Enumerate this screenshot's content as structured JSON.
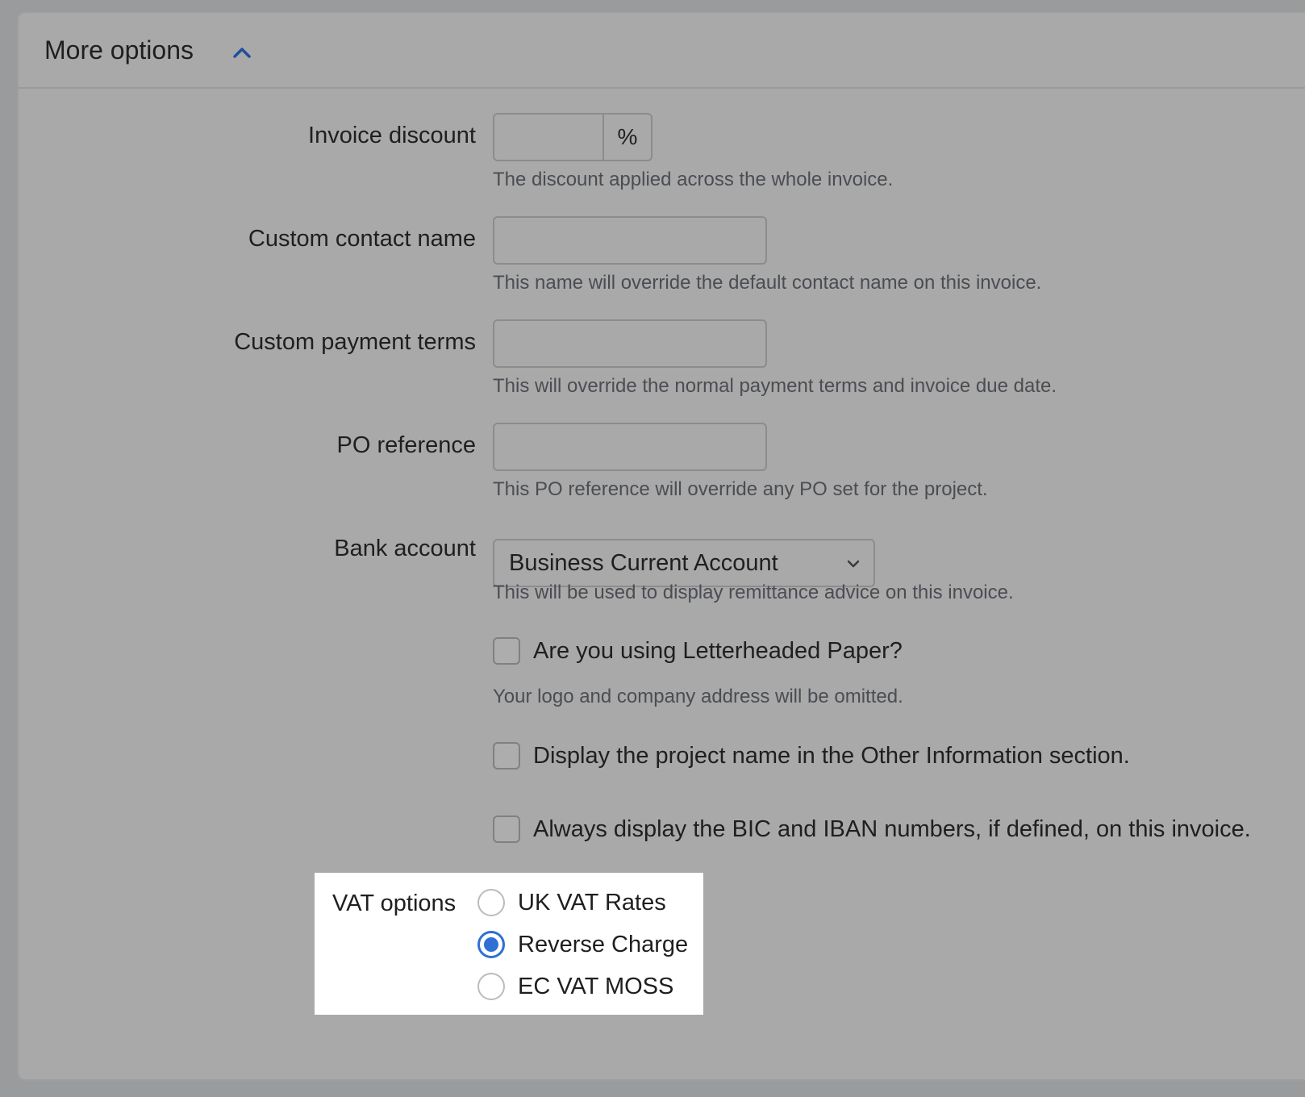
{
  "header": {
    "title": "More options",
    "toggle_icon": "chevron-up-icon",
    "accent_color": "#1f4f9e"
  },
  "invoice_discount": {
    "label": "Invoice discount",
    "value": "",
    "suffix": "%",
    "help": "The discount applied across the whole invoice."
  },
  "custom_contact_name": {
    "label": "Custom contact name",
    "value": "",
    "help": "This name will override the default contact name on this invoice."
  },
  "custom_payment_terms": {
    "label": "Custom payment terms",
    "value": "",
    "help": "This will override the normal payment terms and invoice due date."
  },
  "po_reference": {
    "label": "PO reference",
    "value": "",
    "help": "This PO reference will override any PO set for the project."
  },
  "bank_account": {
    "label": "Bank account",
    "selected": "Business Current Account",
    "help": "This will be used to display remittance advice on this invoice."
  },
  "checkboxes": [
    {
      "label": "Are you using Letterheaded Paper?",
      "checked": false,
      "help": "Your logo and company address will be omitted."
    },
    {
      "label": "Display the project name in the Other Information section.",
      "checked": false
    },
    {
      "label": "Always display the BIC and IBAN numbers, if defined, on this invoice.",
      "checked": false
    }
  ],
  "vat_options": {
    "label": "VAT options",
    "options": [
      "UK VAT Rates",
      "Reverse Charge",
      "EC VAT MOSS"
    ],
    "selected": "Reverse Charge",
    "radio_color": "#2f6fd6"
  }
}
